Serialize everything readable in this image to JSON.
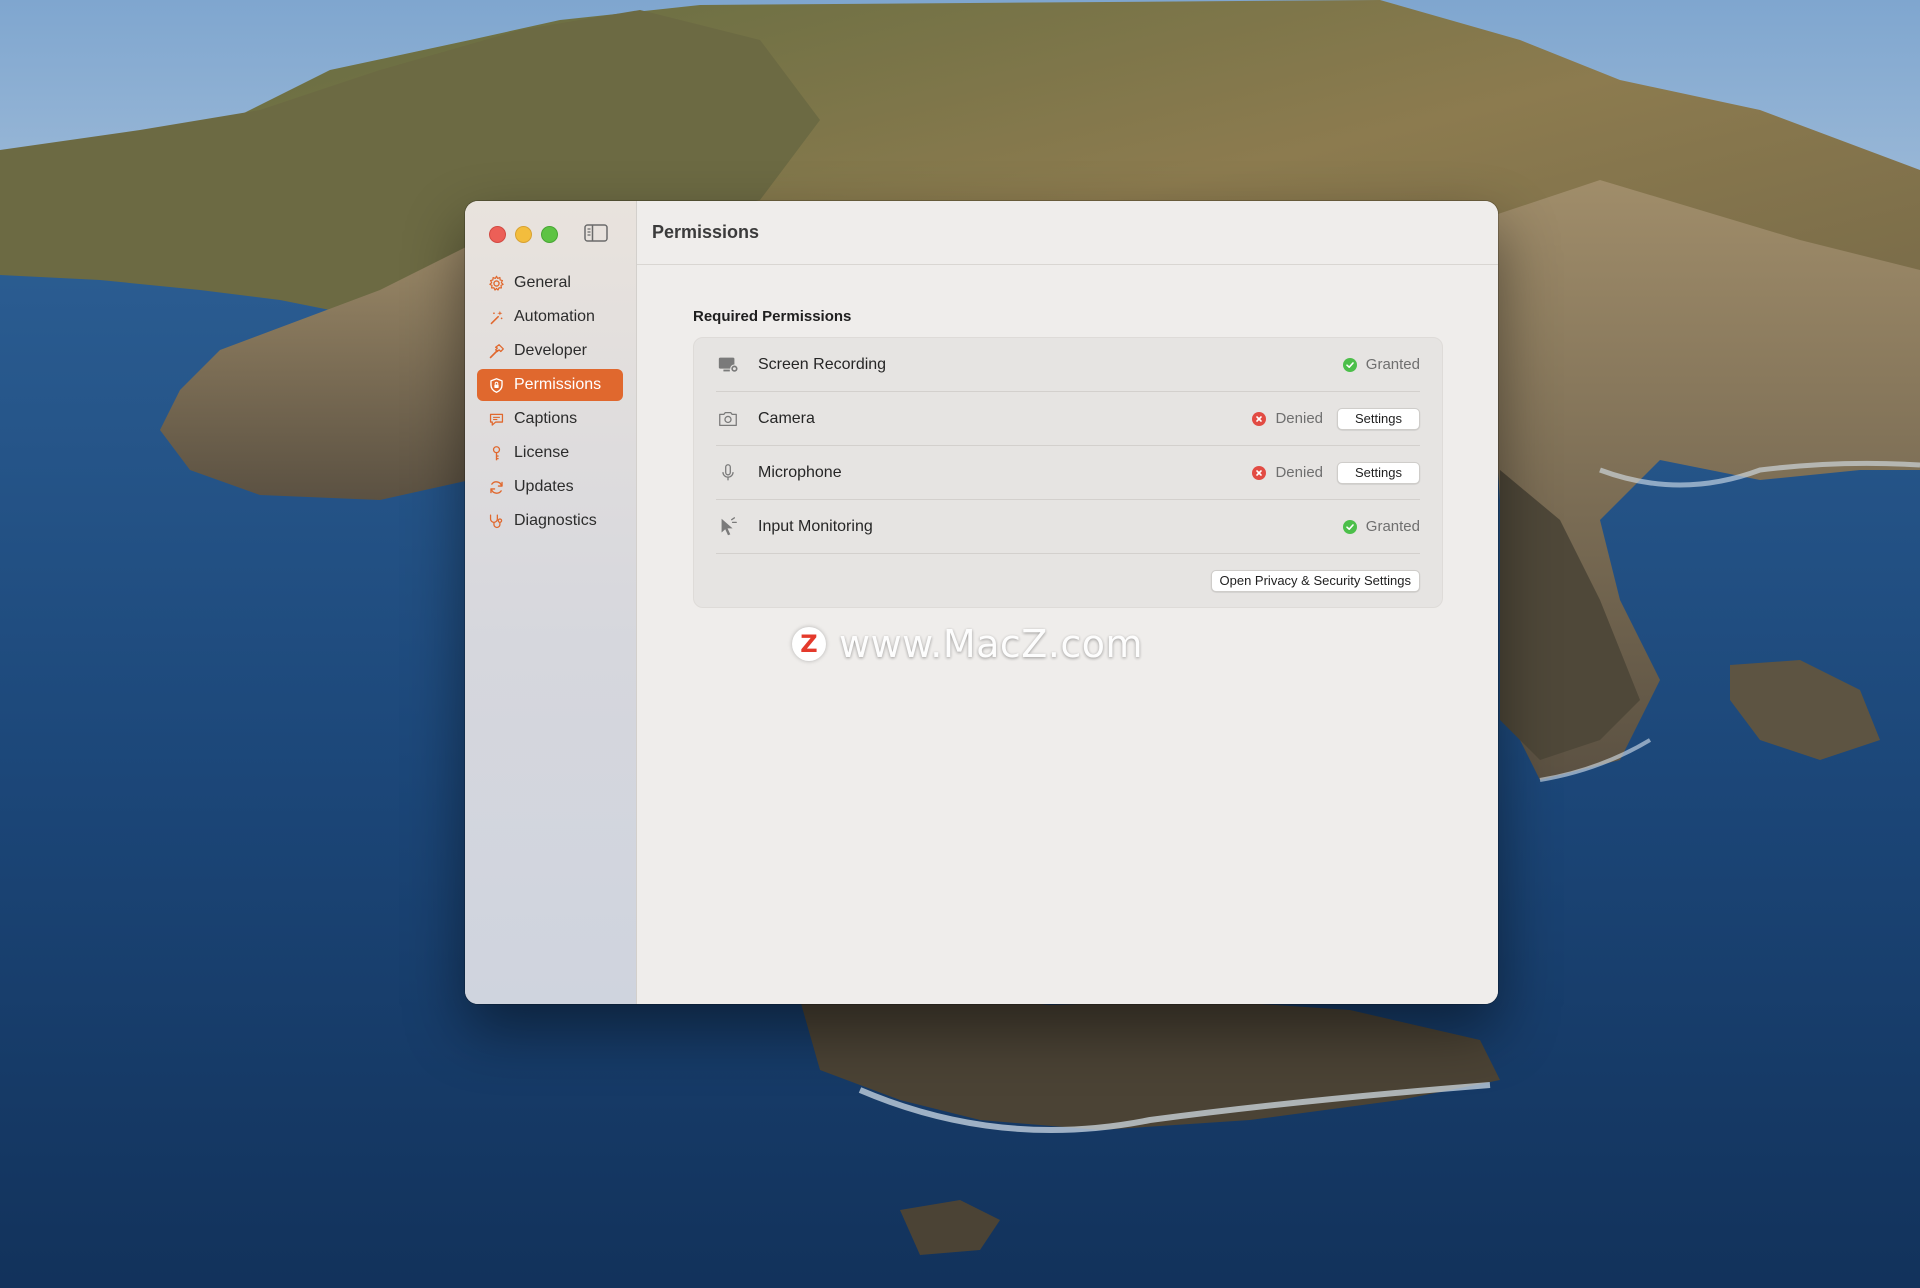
{
  "window": {
    "title": "Permissions"
  },
  "sidebar": {
    "items": [
      {
        "label": "General",
        "icon": "gear-icon",
        "active": false
      },
      {
        "label": "Automation",
        "icon": "magic-wand-icon",
        "active": false
      },
      {
        "label": "Developer",
        "icon": "hammer-icon",
        "active": false
      },
      {
        "label": "Permissions",
        "icon": "shield-icon",
        "active": true
      },
      {
        "label": "Captions",
        "icon": "captions-icon",
        "active": false
      },
      {
        "label": "License",
        "icon": "key-icon",
        "active": false
      },
      {
        "label": "Updates",
        "icon": "refresh-icon",
        "active": false
      },
      {
        "label": "Diagnostics",
        "icon": "stethoscope-icon",
        "active": false
      }
    ]
  },
  "permissions": {
    "section_title": "Required Permissions",
    "rows": [
      {
        "label": "Screen Recording",
        "icon": "screen-recording-icon",
        "status": "Granted",
        "granted": true
      },
      {
        "label": "Camera",
        "icon": "camera-icon",
        "status": "Denied",
        "granted": false,
        "action_label": "Settings"
      },
      {
        "label": "Microphone",
        "icon": "microphone-icon",
        "status": "Denied",
        "granted": false,
        "action_label": "Settings"
      },
      {
        "label": "Input Monitoring",
        "icon": "cursor-icon",
        "status": "Granted",
        "granted": true
      }
    ],
    "open_settings_label": "Open Privacy & Security Settings"
  },
  "watermark": {
    "logo": "Z",
    "text": "www.MacZ.com"
  },
  "colors": {
    "accent": "#e0682e",
    "granted": "#4cbf4a",
    "denied": "#e24b43"
  }
}
